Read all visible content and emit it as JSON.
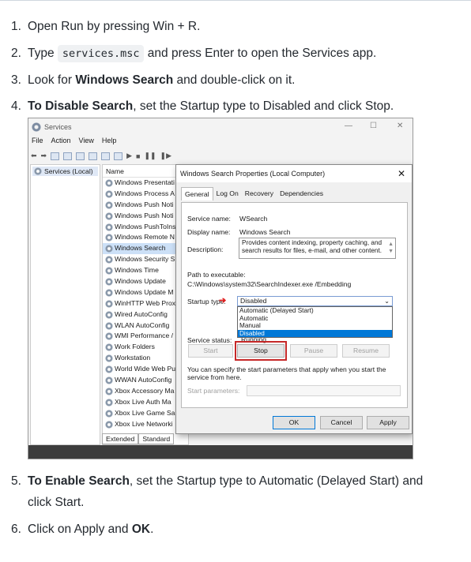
{
  "steps": [
    {
      "num": "1.",
      "parts": {
        "a": "Open Run by pressing Win + R."
      }
    },
    {
      "num": "2.",
      "parts": {
        "a": "Type ",
        "code": "services.msc",
        "b": " and press Enter to open the Services app."
      }
    },
    {
      "num": "3.",
      "parts": {
        "a": "Look for ",
        "bold": "Windows Search",
        "b": " and double-click on it."
      }
    },
    {
      "num": "4.",
      "parts": {
        "bold": "To Disable Search",
        "b": ", set the Startup type to Disabled and click Stop."
      }
    },
    {
      "num": "5.",
      "parts": {
        "bold": "To Enable Search",
        "b": ", set the Startup type to Automatic (Delayed Start) and click Start."
      }
    },
    {
      "num": "6.",
      "parts": {
        "a": "Click on Apply and ",
        "bold": "OK",
        "b": "."
      }
    }
  ],
  "services_window": {
    "title": "Services",
    "controls": {
      "minimize": "—",
      "maximize": "☐",
      "close": "✕"
    },
    "menu": [
      "File",
      "Action",
      "View",
      "Help"
    ],
    "tree_item": "Services (Local)",
    "list_header": "Name",
    "services": [
      "Windows Presentati",
      "Windows Process A",
      "Windows Push Noti",
      "Windows Push Noti",
      "Windows PushToIns",
      "Windows Remote N",
      "Windows Search",
      "Windows Security S",
      "Windows Time",
      "Windows Update",
      "Windows Update M",
      "WinHTTP Web Prox",
      "Wired AutoConfig",
      "WLAN AutoConfig",
      "WMI Performance /",
      "Work Folders",
      "Workstation",
      "World Wide Web Pu",
      "WWAN AutoConfig",
      "Xbox Accessory Ma",
      "Xbox Live Auth Ma",
      "Xbox Live Game Sa",
      "Xbox Live Networki"
    ],
    "selected_service_index": 6,
    "bottom_tabs": [
      "Extended",
      "Standard"
    ]
  },
  "dialog": {
    "title": "Windows Search Properties (Local Computer)",
    "close": "✕",
    "tabs": [
      "General",
      "Log On",
      "Recovery",
      "Dependencies"
    ],
    "active_tab": "General",
    "service_name_label": "Service name:",
    "service_name": "WSearch",
    "display_name_label": "Display name:",
    "display_name": "Windows Search",
    "description_label": "Description:",
    "description": "Provides content indexing, property caching, and search results for files, e-mail, and other content.",
    "path_label": "Path to executable:",
    "path": "C:\\Windows\\system32\\SearchIndexer.exe /Embedding",
    "startup_type_label": "Startup type:",
    "startup_type_value": "Disabled",
    "startup_options": [
      "Automatic (Delayed Start)",
      "Automatic",
      "Manual",
      "Disabled"
    ],
    "startup_selected_index": 3,
    "service_status_label": "Service status:",
    "service_status": "Running",
    "buttons": {
      "start": "Start",
      "stop": "Stop",
      "pause": "Pause",
      "resume": "Resume"
    },
    "hint": "You can specify the start parameters that apply when you start the service from here.",
    "start_params_label": "Start parameters:",
    "footer": {
      "ok": "OK",
      "cancel": "Cancel",
      "apply": "Apply"
    },
    "highlight_color": "#c62828",
    "arrow_color": "#e02020"
  }
}
